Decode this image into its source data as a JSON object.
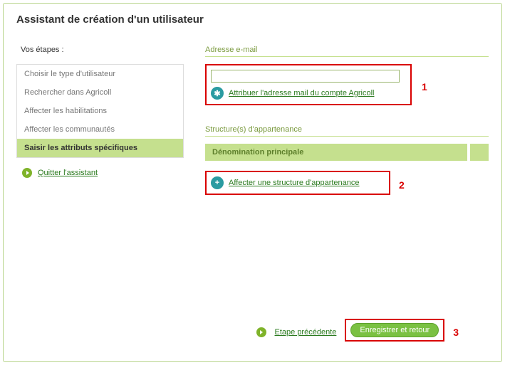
{
  "page_title": "Assistant de création d'un utilisateur",
  "sidebar": {
    "steps_title": "Vos étapes :",
    "steps": [
      {
        "label": "Choisir le type d'utilisateur",
        "current": false
      },
      {
        "label": "Rechercher dans Agricoll",
        "current": false
      },
      {
        "label": "Affecter les habilitations",
        "current": false
      },
      {
        "label": "Affecter les communautés",
        "current": false
      },
      {
        "label": "Saisir les attributs spécifiques",
        "current": true
      }
    ],
    "quit_label": "Quitter l'assistant"
  },
  "main": {
    "email_section": {
      "heading": "Adresse e-mail",
      "input_value": "",
      "assign_link": "Attribuer l'adresse mail du compte Agricoll",
      "marker": "1"
    },
    "structure_section": {
      "heading": "Structure(s) d'appartenance",
      "table_header": "Dénomination principale",
      "assign_link": "Affecter une structure d'appartenance",
      "marker": "2"
    }
  },
  "footer": {
    "prev_label": "Etape précédente",
    "save_label": "Enregistrer et retour",
    "marker": "3"
  },
  "colors": {
    "brand_green": "#7ac142",
    "pale_green": "#c5e08e",
    "dark_link": "#2a7a1e",
    "teal_icon": "#2a9ba1",
    "red": "#d90000"
  }
}
